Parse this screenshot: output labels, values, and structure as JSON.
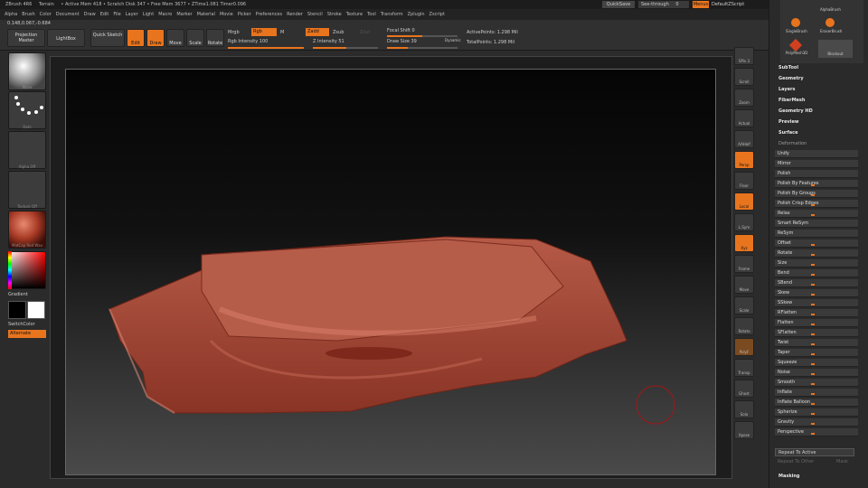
{
  "titlebar": {
    "app": "ZBrush 4R6",
    "doc": "Terrain",
    "stats": "• Active Mem 418 • Scratch Disk 347 • Free Mem 3677 • ZTime1.081 Timer0.096"
  },
  "topright": {
    "quicksave": "QuickSave",
    "seethrough": "See-through",
    "seethrough_val": "0",
    "menus": "Menus",
    "script": "DefaultZScript"
  },
  "menubar": [
    "Alpha",
    "Brush",
    "Color",
    "Document",
    "Draw",
    "Edit",
    "File",
    "Layer",
    "Light",
    "Macro",
    "Marker",
    "Material",
    "Movie",
    "Picker",
    "Preferences",
    "Render",
    "Stencil",
    "Stroke",
    "Texture",
    "Tool",
    "Transform",
    "Zplugin",
    "Zscript"
  ],
  "readout": "0.148,0.067,-0.684",
  "toolbar": {
    "projection_master": "Projection Master",
    "lightbox": "LightBox",
    "quick_sketch": "Quick Sketch",
    "edit": "Edit",
    "draw": "Draw",
    "move": "Move",
    "scale": "Scale",
    "rotate": "Rotate",
    "mrgb": "Mrgb",
    "rgb": "Rgb",
    "m": "M",
    "rgb_intensity": "Rgb Intensity 100",
    "zadd": "Zadd",
    "zsub": "Zsub",
    "zcut": "Zcut",
    "z_intensity": "Z Intensity 51",
    "focal_shift": "Focal Shift 0",
    "draw_size": "Draw Size 39",
    "dynamic": "Dynamic",
    "active_points": "ActivePoints: 1.298 Mil",
    "total_points": "TotalPoints: 1.298 Mil",
    "rgb_intensity_frac": 1.0,
    "z_intensity_frac": 0.51,
    "focal_shift_frac": 0.5,
    "draw_size_frac": 0.3
  },
  "leftshelf": {
    "move": "Move",
    "dots": "Dots",
    "alpha": "Alpha Off",
    "texture": "Texture Off",
    "material": "MatCap Red Wax",
    "gradient": "Gradient",
    "switchcolor": "SwitchColor",
    "alternate": "Alternate"
  },
  "rightshelf": [
    "SPix 3",
    "Scroll",
    "Zoom",
    "Actual",
    "AAHalf",
    "Persp",
    "Floor",
    "Local",
    "L.Sym",
    "Xyz",
    "Frame",
    "Move",
    "Scale",
    "Rotate",
    "PolyF",
    "Transp",
    "Ghost",
    "Solo",
    "Xpose"
  ],
  "tray": {
    "brushes": [
      "AlphaBrush",
      "SingleBrush",
      "EraserBrush",
      "PolyMesh3D",
      "Blockout"
    ],
    "headers": [
      "SubTool",
      "Geometry",
      "Layers",
      "FiberMesh",
      "Geometry HD",
      "Preview",
      "Surface",
      "Deformation"
    ],
    "deformation": [
      {
        "label": "Unify",
        "slider": false
      },
      {
        "label": "Mirror",
        "slider": false
      },
      {
        "label": "Polish",
        "slider": false
      },
      {
        "label": "Polish By Features",
        "slider": true
      },
      {
        "label": "Polish By Groups",
        "slider": true
      },
      {
        "label": "Polish Crisp Edges",
        "slider": true
      },
      {
        "label": "Relax",
        "slider": true
      },
      {
        "label": "Smart ReSym",
        "slider": false
      },
      {
        "label": "ReSym",
        "slider": false
      },
      {
        "label": "Offset",
        "slider": true
      },
      {
        "label": "Rotate",
        "slider": true
      },
      {
        "label": "Size",
        "slider": true
      },
      {
        "label": "Bend",
        "slider": true
      },
      {
        "label": "SBend",
        "slider": true
      },
      {
        "label": "Skew",
        "slider": true
      },
      {
        "label": "SSkew",
        "slider": true
      },
      {
        "label": "RFlatten",
        "slider": true
      },
      {
        "label": "Flatten",
        "slider": true
      },
      {
        "label": "SFlatten",
        "slider": true
      },
      {
        "label": "Twist",
        "slider": true
      },
      {
        "label": "Taper",
        "slider": true
      },
      {
        "label": "Squeeze",
        "slider": true
      },
      {
        "label": "Noise",
        "slider": true
      },
      {
        "label": "Smooth",
        "slider": true
      },
      {
        "label": "Inflate",
        "slider": true
      },
      {
        "label": "Inflate Balloon",
        "slider": true
      },
      {
        "label": "Spherize",
        "slider": true
      },
      {
        "label": "Gravity",
        "slider": true
      },
      {
        "label": "Perspective",
        "slider": true
      }
    ],
    "repeat_active": "Repeat To Active",
    "repeat_other": "Repeat To Other",
    "mask": "Mask",
    "masking": "Masking"
  },
  "colors": {
    "accent": "#e8741e",
    "clay": "#b0513f"
  }
}
